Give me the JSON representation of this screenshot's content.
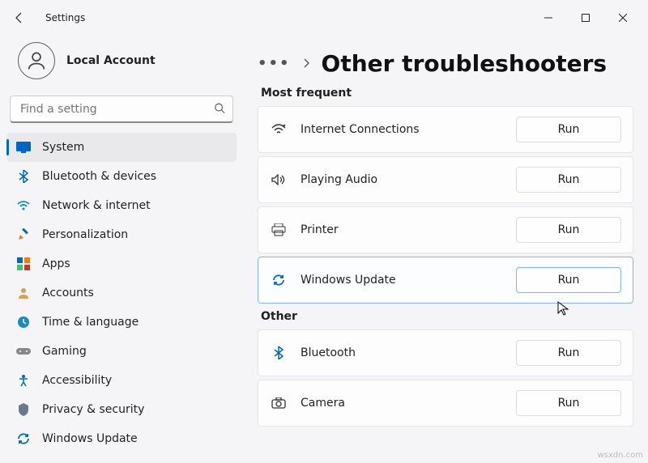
{
  "window": {
    "title": "Settings"
  },
  "account": {
    "name": "Local Account"
  },
  "search": {
    "placeholder": "Find a setting"
  },
  "sidebar": {
    "items": [
      {
        "label": "System",
        "icon": "system",
        "active": true
      },
      {
        "label": "Bluetooth & devices",
        "icon": "bluetooth",
        "active": false
      },
      {
        "label": "Network & internet",
        "icon": "network",
        "active": false
      },
      {
        "label": "Personalization",
        "icon": "personalization",
        "active": false
      },
      {
        "label": "Apps",
        "icon": "apps",
        "active": false
      },
      {
        "label": "Accounts",
        "icon": "accounts",
        "active": false
      },
      {
        "label": "Time & language",
        "icon": "time",
        "active": false
      },
      {
        "label": "Gaming",
        "icon": "gaming",
        "active": false
      },
      {
        "label": "Accessibility",
        "icon": "accessibility",
        "active": false
      },
      {
        "label": "Privacy & security",
        "icon": "privacy",
        "active": false
      },
      {
        "label": "Windows Update",
        "icon": "update",
        "active": false
      }
    ]
  },
  "breadcrumb": {
    "ellipsis": "…",
    "title": "Other troubleshooters"
  },
  "sections": [
    {
      "title": "Most frequent",
      "items": [
        {
          "icon": "wifi",
          "label": "Internet Connections",
          "button": "Run",
          "selected": false
        },
        {
          "icon": "audio",
          "label": "Playing Audio",
          "button": "Run",
          "selected": false
        },
        {
          "icon": "printer",
          "label": "Printer",
          "button": "Run",
          "selected": false
        },
        {
          "icon": "update",
          "label": "Windows Update",
          "button": "Run",
          "selected": true
        }
      ]
    },
    {
      "title": "Other",
      "items": [
        {
          "icon": "bluetooth",
          "label": "Bluetooth",
          "button": "Run",
          "selected": false
        },
        {
          "icon": "camera",
          "label": "Camera",
          "button": "Run",
          "selected": false
        }
      ]
    }
  ],
  "watermark": "wsxdn.com"
}
